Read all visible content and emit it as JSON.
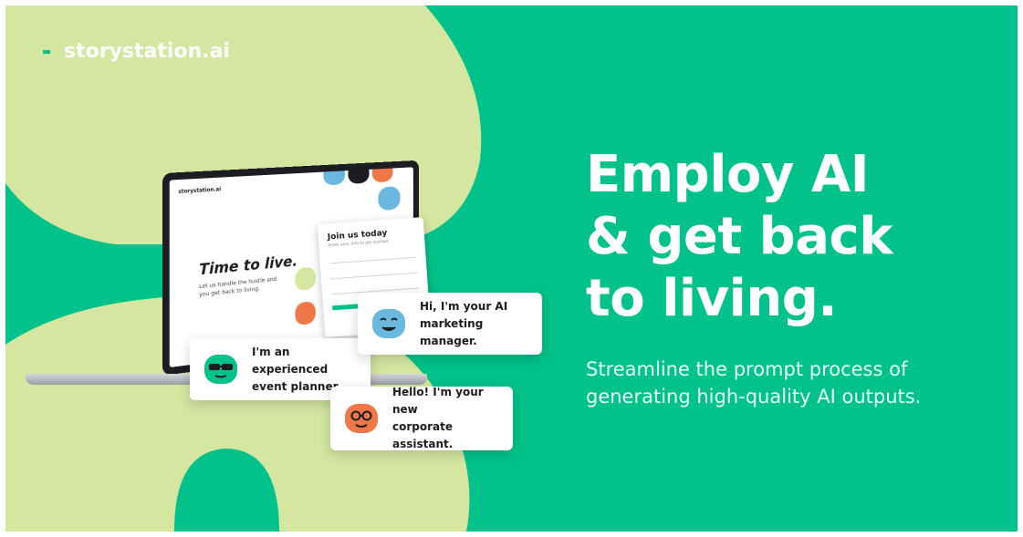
{
  "brand": {
    "name": "storystation.ai",
    "icon": "hourglass-logo-icon"
  },
  "hero": {
    "headline_lines": [
      "Employ AI",
      "& get back",
      "to living."
    ],
    "subline_lines": [
      "Streamline the prompt process of",
      "generating high-quality AI outputs."
    ]
  },
  "laptop": {
    "brand": "storystation.ai",
    "title": "Time to live.",
    "subtitle": "Let us handle the hustle and you get back to living.",
    "join_card": {
      "title": "Join us today",
      "subtitle": "Enter your info to get started."
    }
  },
  "chat_cards": [
    {
      "lines": [
        "Hi, I'm your AI",
        "marketing manager."
      ],
      "avatar": "blue-smiling-face-icon"
    },
    {
      "lines": [
        "I'm an experienced",
        "event planner."
      ],
      "avatar": "green-sunglasses-face-icon"
    },
    {
      "lines": [
        "Hello! I'm your new",
        "corporate assistant."
      ],
      "avatar": "orange-glasses-face-icon"
    }
  ],
  "colors": {
    "brand_green": "#00c28a",
    "pale_green": "#d4e6a0",
    "dark": "#1c1d22",
    "blue": "#6ab8e0",
    "orange": "#f07848"
  }
}
